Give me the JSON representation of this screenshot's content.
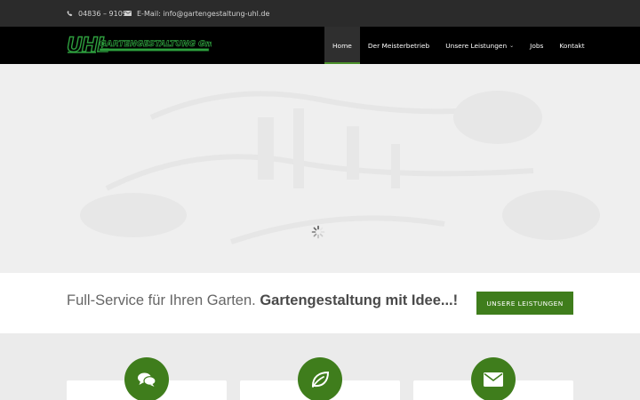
{
  "topbar": {
    "phone": "04836 – 9109",
    "email": "E-Mail: info@gartengestaltung-uhl.de",
    "phone_icon": "phone-icon",
    "mail_icon": "envelope-icon"
  },
  "brand": {
    "logo_mark": "UHL",
    "logo_text": "GARTENGESTALTUNG GmbH",
    "logo_color": "#2e9e3e"
  },
  "nav": {
    "items": [
      {
        "label": "Home",
        "active": true
      },
      {
        "label": "Der Meisterbetrieb"
      },
      {
        "label": "Unsere Leistungen",
        "has_dropdown": true
      },
      {
        "label": "Jobs"
      },
      {
        "label": "Kontakt"
      }
    ],
    "dropdown_icon": "chevron-down-icon"
  },
  "hero": {
    "state": "loading",
    "spinner_icon": "loading-spinner-icon"
  },
  "cta": {
    "text_light": "Full-Service für Ihren Garten.",
    "text_bold": "Gartengestaltung mit Idee...!",
    "button_label": "UNSERE LEISTUNGEN"
  },
  "features": {
    "items": [
      {
        "icon": "speech-bubbles-icon"
      },
      {
        "icon": "leaf-icon"
      },
      {
        "icon": "envelope-icon"
      }
    ]
  },
  "colors": {
    "accent_green": "#3f7d1c",
    "topbar_bg": "#2b2b2b",
    "navbar_bg": "#000000"
  }
}
